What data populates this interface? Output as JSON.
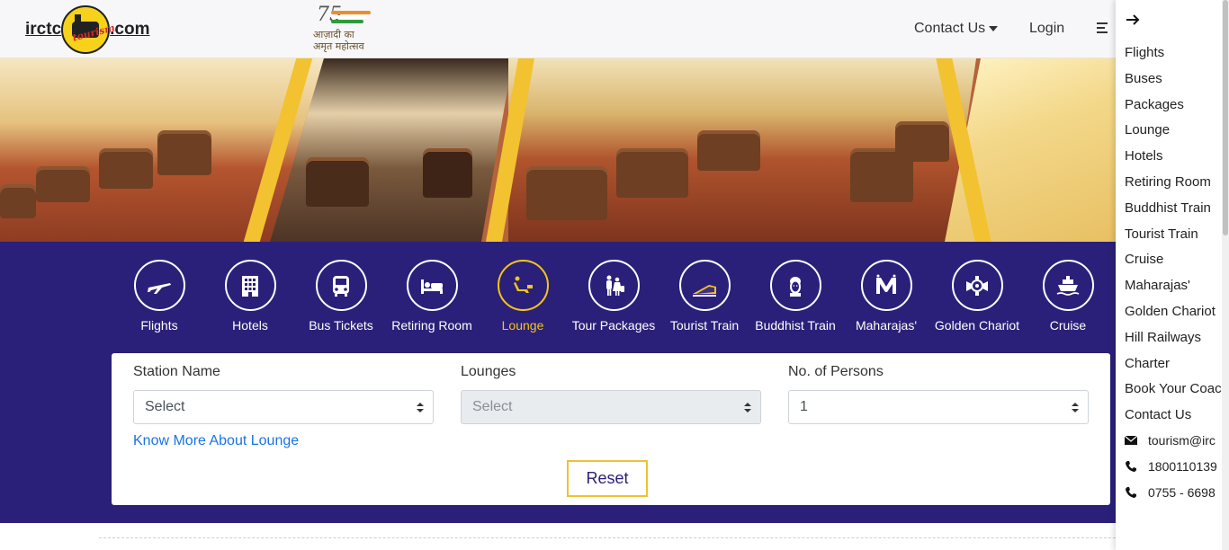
{
  "header": {
    "logo": {
      "left_text": "irctc",
      "badge_text": "tourism",
      "right_text": ".com"
    },
    "azadi": {
      "number": "75",
      "line1": "आज़ादी का",
      "line2": "अमृत महोत्सव"
    },
    "nav": {
      "contact": "Contact Us",
      "login": "Login"
    }
  },
  "services": [
    {
      "label": "Flights",
      "icon": "plane-icon"
    },
    {
      "label": "Hotels",
      "icon": "hotel-icon"
    },
    {
      "label": "Bus Tickets",
      "icon": "bus-icon"
    },
    {
      "label": "Retiring Room",
      "icon": "bed-icon"
    },
    {
      "label": "Lounge",
      "icon": "lounge-icon",
      "active": true
    },
    {
      "label": "Tour Packages",
      "icon": "family-icon"
    },
    {
      "label": "Tourist Train",
      "icon": "train-icon"
    },
    {
      "label": "Buddhist Train",
      "icon": "buddha-icon"
    },
    {
      "label": "Maharajas'",
      "icon": "maharajas-emblem-icon"
    },
    {
      "label": "Golden Chariot",
      "icon": "chariot-emblem-icon"
    },
    {
      "label": "Cruise",
      "icon": "ship-icon"
    }
  ],
  "form": {
    "station": {
      "label": "Station Name",
      "value": "Select"
    },
    "lounges": {
      "label": "Lounges",
      "value": "Select"
    },
    "persons": {
      "label": "No. of Persons",
      "value": "1"
    },
    "know_more": "Know More About Lounge",
    "reset": "Reset"
  },
  "sidenav": {
    "items": [
      "Flights",
      "Buses",
      "Packages",
      "Lounge",
      "Hotels",
      "Retiring Room",
      "Buddhist Train",
      "Tourist Train",
      "Cruise",
      "Maharajas'",
      "Golden Chariot",
      "Hill Railways",
      "Charter",
      "Book Your Coac",
      "Contact Us"
    ],
    "email": "tourism@irc",
    "phone1": "1800110139",
    "phone2": "0755 - 6698"
  },
  "colors": {
    "services_bg": "#2b2079",
    "accent": "#f5c518",
    "link": "#1a73e8"
  }
}
